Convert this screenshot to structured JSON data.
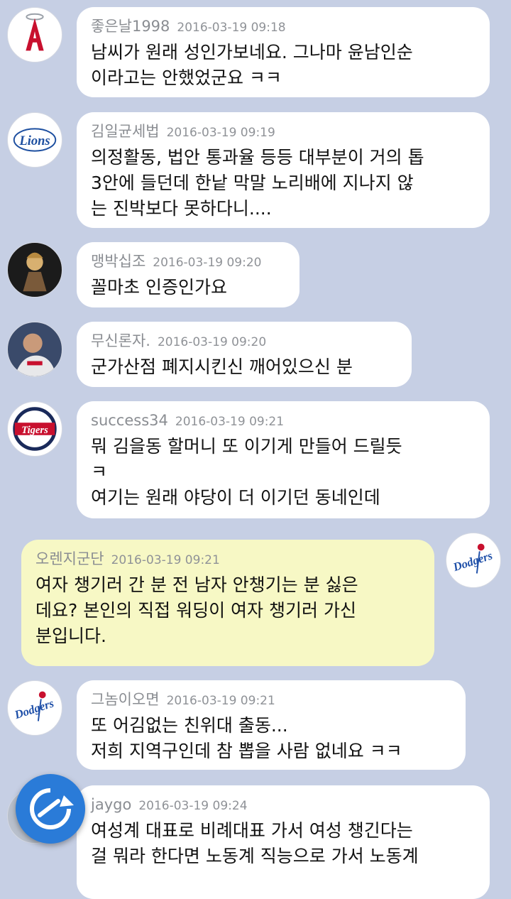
{
  "messages": [
    {
      "nick": "좋은날1998",
      "time": "2016-03-19 09:18",
      "text": "남씨가 원래 성인가보네요. 그나마 윤남인순\n이라고는 안했었군요 ㅋㅋ",
      "avatar": "angels-logo"
    },
    {
      "nick": "김일균세법",
      "time": "2016-03-19 09:19",
      "text": "의정활동, 법안 통과율 등등 대부분이 거의 톱\n3안에 들던데 한낱 막말 노리배에 지나지 않\n는 진박보다 못하다니....",
      "avatar": "lions-logo"
    },
    {
      "nick": "맹박십조",
      "time": "2016-03-19 09:20",
      "text": "꼴마초 인증인가요",
      "avatar": "character-avatar"
    },
    {
      "nick": "무신론자.",
      "time": "2016-03-19 09:20",
      "text": "군가산점 폐지시킨신 깨어있으신 분",
      "avatar": "player-photo"
    },
    {
      "nick": "success34",
      "time": "2016-03-19 09:21",
      "text": "뭐 김을동 할머니 또 이기게 만들어 드릴듯\nㅋ\n여기는 원래 야당이 더 이기던 동네인데",
      "avatar": "tigers-logo"
    },
    {
      "nick": "오렌지군단",
      "time": "2016-03-19 09:21",
      "text": "여자 챙기러 간 분 전 남자 안챙기는 분 싫은\n데요? 본인의 직접 워딩이 여자 챙기러 가신\n분입니다.",
      "avatar": "dodgers-logo"
    },
    {
      "nick": "그놈이오면",
      "time": "2016-03-19 09:21",
      "text": "또 어김없는 친위대 출동...\n저희 지역구인데 참 뽑을 사람 없네요 ㅋㅋ",
      "avatar": "dodgers-logo"
    },
    {
      "nick": "jaygo",
      "time": "2016-03-19 09:24",
      "text": "여성계 대표로 비례대표 가서 여성 챙긴다는\n걸 뭐라 한다면 노동계 직능으로 가서 노동계",
      "avatar": "blue-avatar"
    }
  ],
  "floating_button": {
    "icon": "refresh-icon",
    "color": "#2a7bd8"
  },
  "colors": {
    "background": "#c6cfe4",
    "bubble": "#ffffff",
    "my_bubble": "#f7f8c5",
    "nick": "#8a8d92"
  }
}
